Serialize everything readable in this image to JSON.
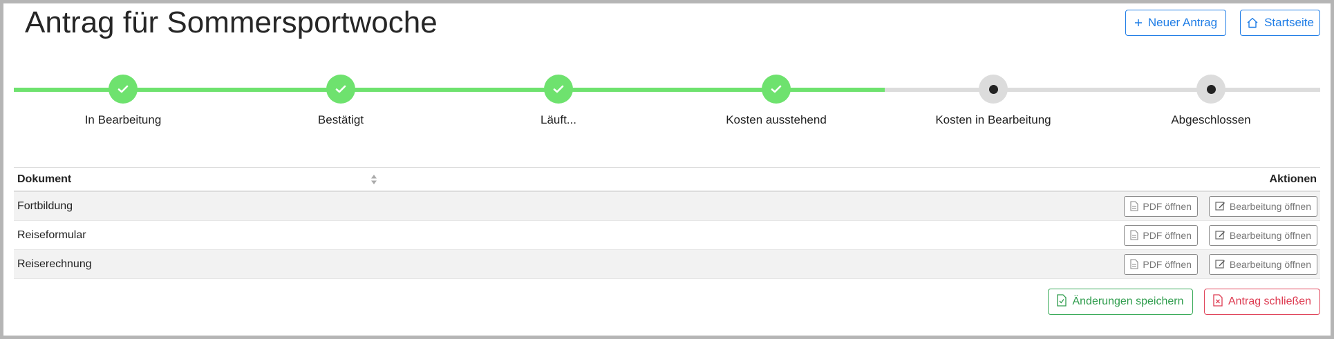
{
  "page": {
    "title": "Antrag für Sommersportwoche"
  },
  "header": {
    "new_request_label": "Neuer Antrag",
    "home_label": "Startseite"
  },
  "stepper": {
    "completed_color": "#6ee26e",
    "pending_color": "#dcdcdc",
    "steps": [
      {
        "label": "In Bearbeitung",
        "status": "done"
      },
      {
        "label": "Bestätigt",
        "status": "done"
      },
      {
        "label": "Läuft...",
        "status": "done"
      },
      {
        "label": "Kosten ausstehend",
        "status": "done"
      },
      {
        "label": "Kosten in Bearbeitung",
        "status": "pending"
      },
      {
        "label": "Abgeschlossen",
        "status": "pending"
      }
    ]
  },
  "table": {
    "col_document": "Dokument",
    "col_actions": "Aktionen",
    "pdf_label": "PDF öffnen",
    "edit_label": "Bearbeitung öffnen",
    "rows": [
      {
        "name": "Fortbildung"
      },
      {
        "name": "Reiseformular"
      },
      {
        "name": "Reiserechnung"
      }
    ]
  },
  "footer": {
    "save_label": "Änderungen speichern",
    "close_label": "Antrag schließen",
    "save_color": "#2e9c4c",
    "close_color": "#dd3a50"
  }
}
